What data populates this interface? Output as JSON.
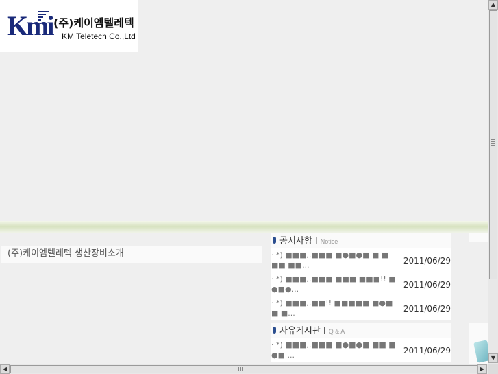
{
  "company": {
    "logo_mark": "Kmi",
    "name_ko": "(주)케이엠텔레텍",
    "name_en": "KM Teletech Co.,Ltd"
  },
  "page_title": "(주)케이엠텔레텍 생산장비소개",
  "notice": {
    "title": "공지사항",
    "sep": "l",
    "subtitle": "Notice",
    "items": [
      {
        "title": "· *) ■■■,.■■■ ■●■●■ ■ ■ ■■ ■■...",
        "date": "2011/06/29"
      },
      {
        "title": "· *) ■■■,.■■■ ■■■ ■■■!! ■ ●■●...",
        "date": "2011/06/29"
      },
      {
        "title": "· *) ■■■,.■■!! ■■■■■ ■●■ ■ ■...",
        "date": "2011/06/29"
      }
    ]
  },
  "qna": {
    "title": "자유게시판",
    "sep": "l",
    "subtitle": "Q & A",
    "items": [
      {
        "title": "· *) ■■■,.■■■ ■●■●■ ■■ ■ ●■ ...",
        "date": "2011/06/29"
      }
    ]
  },
  "scrollbar": {
    "up": "▲",
    "down": "▼",
    "left": "◀",
    "right": "▶"
  }
}
